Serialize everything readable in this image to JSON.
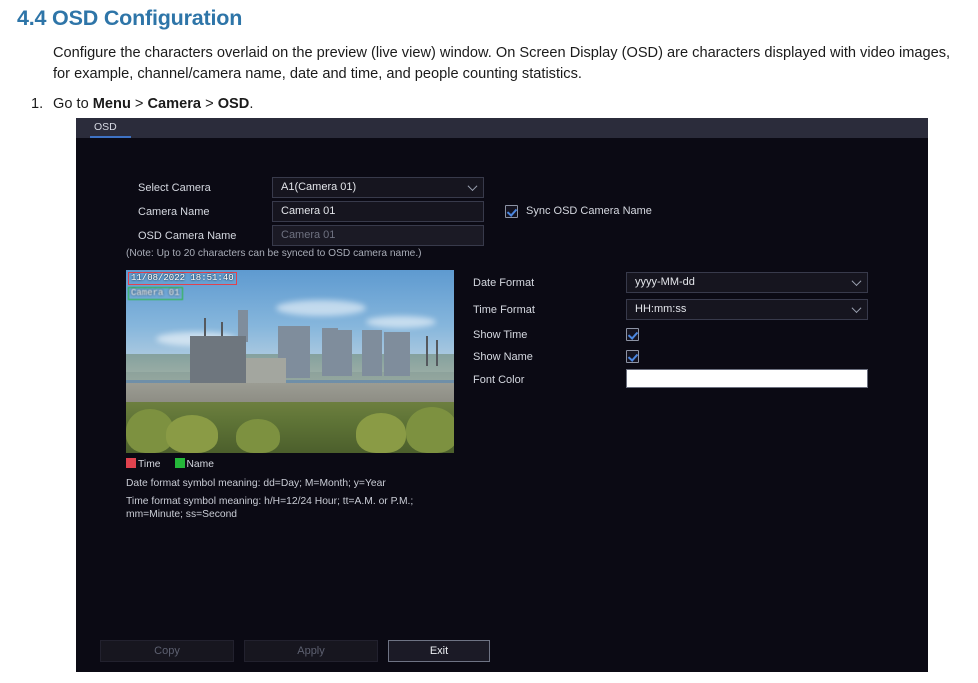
{
  "document": {
    "heading": "4.4 OSD Configuration",
    "paragraph": "Configure the characters overlaid on the preview (live view) window. On Screen Display (OSD) are characters displayed with video images, for example, channel/camera name, date and time, and people counting statistics.",
    "step_number": "1.",
    "step_prefix": "Go to ",
    "step_menu": "Menu",
    "step_sep1": " > ",
    "step_camera": "Camera",
    "step_sep2": " > ",
    "step_osd": "OSD",
    "step_suffix": "."
  },
  "panel": {
    "tab_label": "OSD",
    "form": {
      "select_camera_label": "Select Camera",
      "select_camera_value": "A1(Camera 01)",
      "camera_name_label": "Camera Name",
      "camera_name_value": "Camera 01",
      "osd_camera_name_label": "OSD Camera Name",
      "osd_camera_name_value": "Camera 01",
      "note": "(Note: Up to 20 characters can be synced to OSD camera name.)",
      "sync_checkbox_label": "Sync OSD Camera Name",
      "sync_checkbox_checked": true
    },
    "settings": {
      "date_format_label": "Date Format",
      "date_format_value": "yyyy-MM-dd",
      "time_format_label": "Time Format",
      "time_format_value": "HH:mm:ss",
      "show_time_label": "Show Time",
      "show_time_checked": true,
      "show_name_label": "Show Name",
      "show_name_checked": true,
      "font_color_label": "Font Color",
      "font_color_value": "#ffffff"
    },
    "preview": {
      "osd_time_text": "11/08/2022 18:51:40",
      "osd_name_text": "Camera 01",
      "time_box_color": "#e0424e",
      "name_box_color": "#25b83a"
    },
    "legend": {
      "time_label": "Time",
      "name_label": "Name",
      "date_hint": "Date format symbol meaning: dd=Day; M=Month; y=Year",
      "time_hint_line1": "Time format symbol meaning: h/H=12/24 Hour; tt=A.M. or P.M.;",
      "time_hint_line2": "mm=Minute; ss=Second"
    },
    "buttons": {
      "copy": "Copy",
      "apply": "Apply",
      "exit": "Exit"
    }
  }
}
